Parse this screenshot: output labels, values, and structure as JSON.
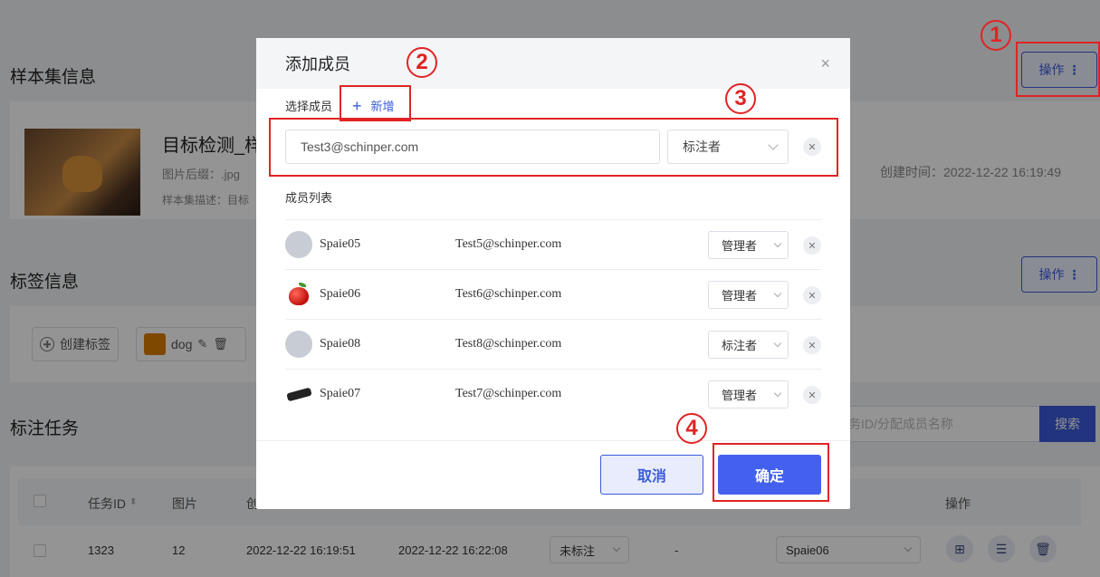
{
  "background": {
    "sample_info_title": "样本集信息",
    "operate_label": "操作",
    "dataset_title": "目标检测_样",
    "image_suffix": "图片后缀：.jpg",
    "dataset_desc": "样本集描述：目标",
    "created_time": "创建时间：2022-12-22 16:19:49",
    "tag_info_title": "标签信息",
    "create_tag_label": "创建标签",
    "tag_name": "dog",
    "annotation_task_title": "标注任务",
    "search_placeholder": "务ID/分配成员名称",
    "search_label": "搜索",
    "table": {
      "headers": [
        "任务ID",
        "图片",
        "创",
        "操作"
      ],
      "row": {
        "id": "1323",
        "images": "12",
        "created": "2022-12-22 16:19:51",
        "updated": "2022-12-22 16:22:08",
        "status": "未标注",
        "dash": "-",
        "assignee": "Spaie06"
      }
    }
  },
  "modal": {
    "title": "添加成员",
    "close_icon": "×",
    "select_member_label": "选择成员",
    "add_label": "新增",
    "new_member": {
      "email": "Test3@schinper.com",
      "role": "标注者"
    },
    "member_list_label": "成员列表",
    "members": [
      {
        "name": "Spaie05",
        "email": "Test5@schinper.com",
        "role": "管理者",
        "avatar": "gray"
      },
      {
        "name": "Spaie06",
        "email": "Test6@schinper.com",
        "role": "管理者",
        "avatar": "apple"
      },
      {
        "name": "Spaie08",
        "email": "Test8@schinper.com",
        "role": "标注者",
        "avatar": "gray"
      },
      {
        "name": "Spaie07",
        "email": "Test7@schinper.com",
        "role": "管理者",
        "avatar": "dark"
      }
    ],
    "cancel_label": "取消",
    "confirm_label": "确定"
  },
  "annotations": {
    "n1": "1",
    "n2": "2",
    "n3": "3",
    "n4": "4"
  },
  "colors": {
    "primary": "#3b5bdb",
    "annotation_red": "#e02424",
    "tag_orange": "#d97c00"
  }
}
